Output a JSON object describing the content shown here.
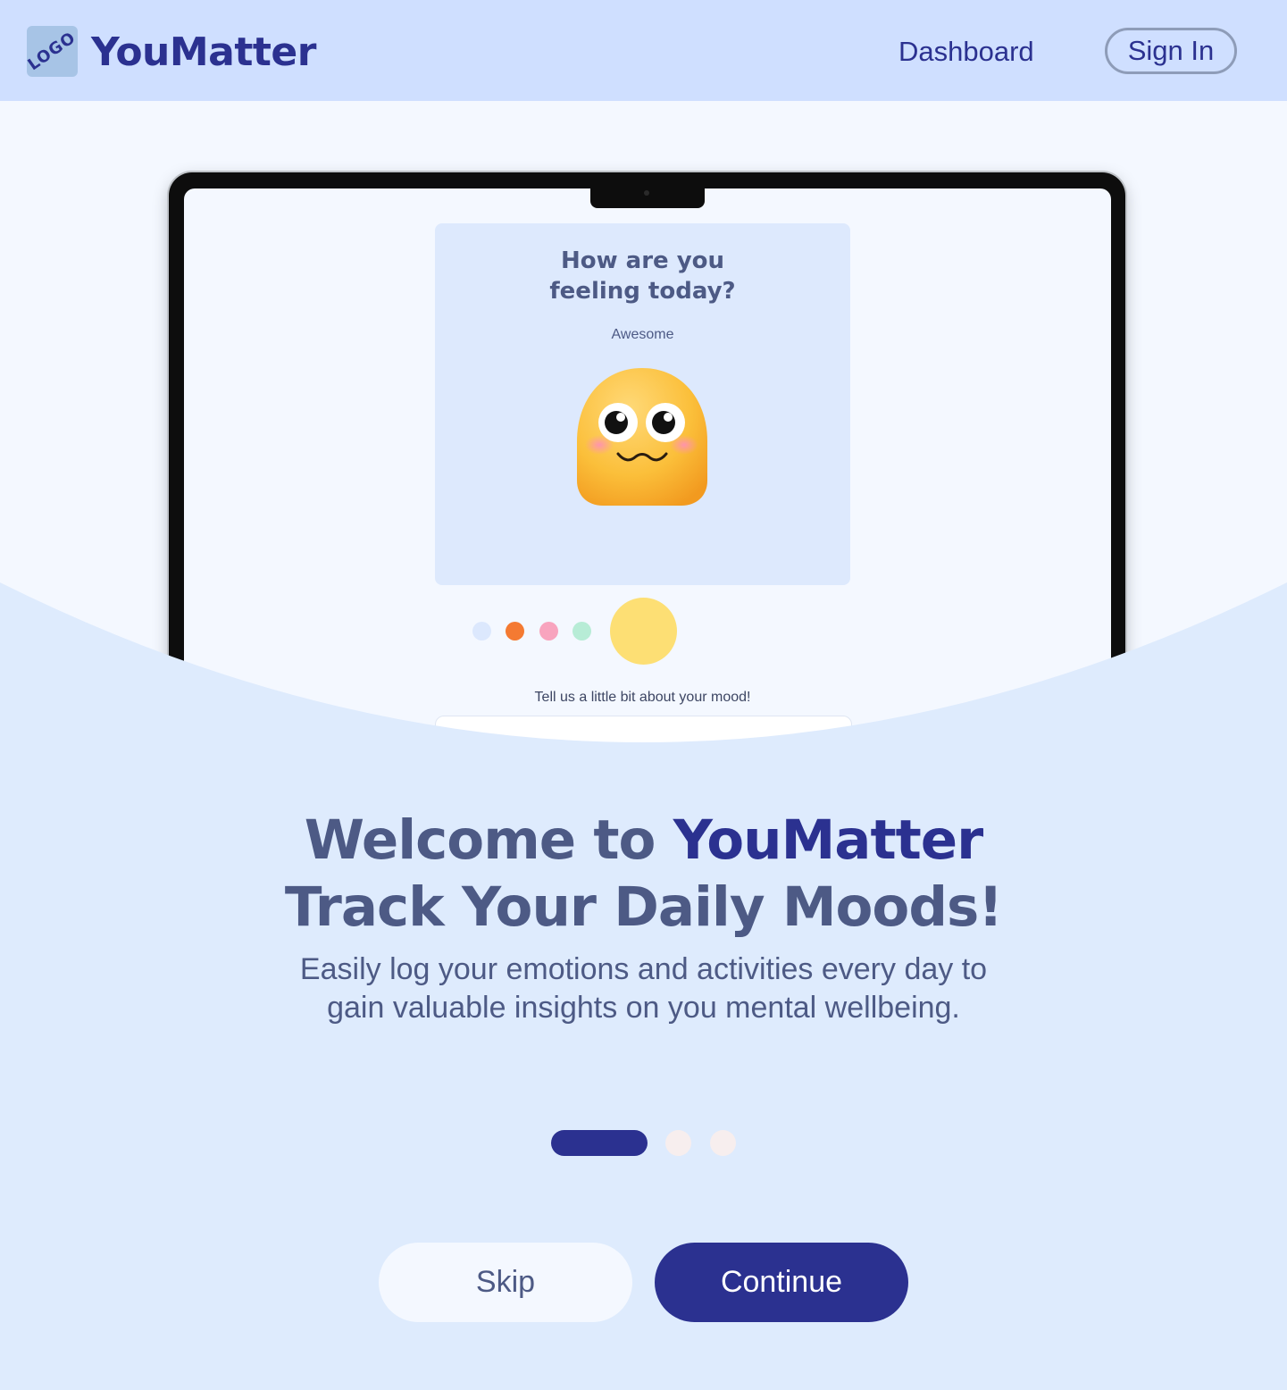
{
  "header": {
    "logo_text": "LOGO",
    "brand": "YouMatter",
    "nav_dashboard": "Dashboard",
    "sign_in": "Sign In"
  },
  "device_preview": {
    "question_line1": "How are you",
    "question_line2": "feeling today?",
    "mood_value": "Awesome",
    "mood_colors": [
      "#dce8fd",
      "#f47a32",
      "#f8a4be",
      "#b7ecd6",
      "#fddf74"
    ],
    "selected_mood_color": "#fddf74",
    "mood_prompt": "Tell us a little bit about your mood!"
  },
  "hero": {
    "headline_prefix": "Welcome to ",
    "headline_brand": "YouMatter",
    "headline_line2": "Track Your Daily Moods!",
    "subtext": "Easily log your emotions and activities every day to gain valuable insights on you mental wellbeing."
  },
  "pager": {
    "current": 1,
    "total": 3
  },
  "actions": {
    "skip": "Skip",
    "continue": "Continue"
  },
  "colors": {
    "brand": "#2b3190",
    "header_bg": "#cfdfff",
    "hero_bg": "#deebfd",
    "text_muted": "#4d5a85"
  }
}
